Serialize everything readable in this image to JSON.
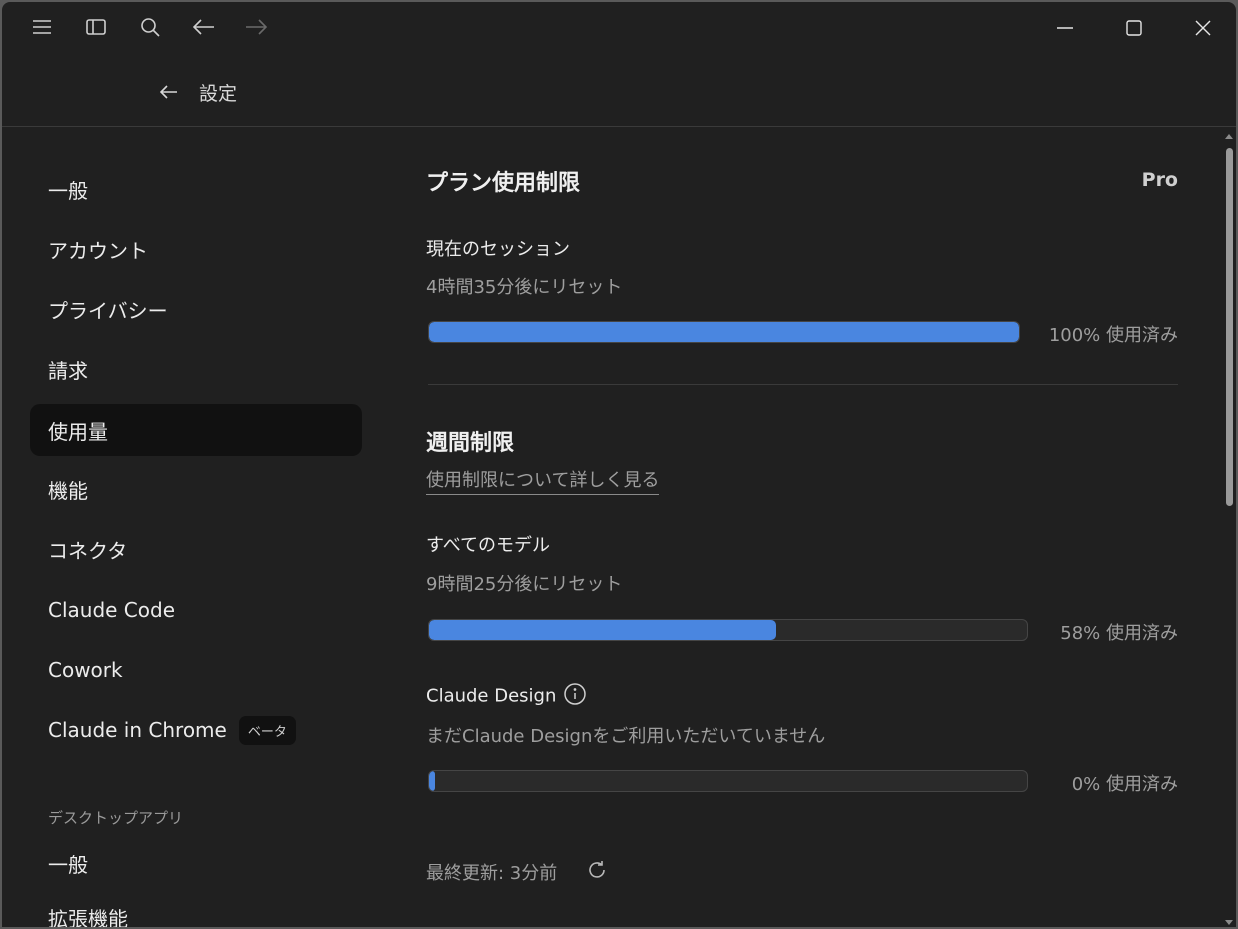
{
  "header": {
    "title": "設定"
  },
  "sidebar": {
    "items": [
      {
        "label": "一般"
      },
      {
        "label": "アカウント"
      },
      {
        "label": "プライバシー"
      },
      {
        "label": "請求"
      },
      {
        "label": "使用量"
      },
      {
        "label": "機能"
      },
      {
        "label": "コネクタ"
      },
      {
        "label": "Claude Code"
      },
      {
        "label": "Cowork"
      },
      {
        "label": "Claude in Chrome",
        "badge": "ベータ"
      }
    ],
    "active_item": "使用量",
    "desktop_section_label": "デスクトップアプリ",
    "desktop_items": [
      {
        "label": "一般"
      },
      {
        "label": "拡張機能"
      }
    ]
  },
  "main": {
    "plan_title": "プラン使用制限",
    "plan_name": "Pro",
    "session": {
      "label": "現在のセッション",
      "reset": "4時間35分後にリセット",
      "percent": 100,
      "percent_label": "100% 使用済み"
    },
    "weekly": {
      "title": "週間制限",
      "learn_more": "使用制限について詳しく見る",
      "all_models": {
        "label": "すべてのモデル",
        "reset": "9時間25分後にリセット",
        "percent": 58,
        "percent_label": "58% 使用済み"
      },
      "design": {
        "label": "Claude Design",
        "status": "まだClaude Designをご利用いただいていません",
        "percent": 0,
        "percent_label": "0% 使用済み"
      }
    },
    "last_updated": "最終更新: 3分前"
  },
  "colors": {
    "window_bg": "#202020",
    "active_nav_bg": "#111111",
    "progress_fill": "#4a86e0",
    "progress_track": "#2a2a2a"
  },
  "icons": {
    "menu": "menu-icon",
    "sidebar_toggle": "sidebar-toggle-icon",
    "search": "search-icon",
    "back": "arrow-left-icon",
    "forward": "arrow-right-icon",
    "minimize": "minimize-icon",
    "maximize": "maximize-icon",
    "close": "close-icon",
    "info": "info-icon",
    "refresh": "refresh-icon"
  }
}
